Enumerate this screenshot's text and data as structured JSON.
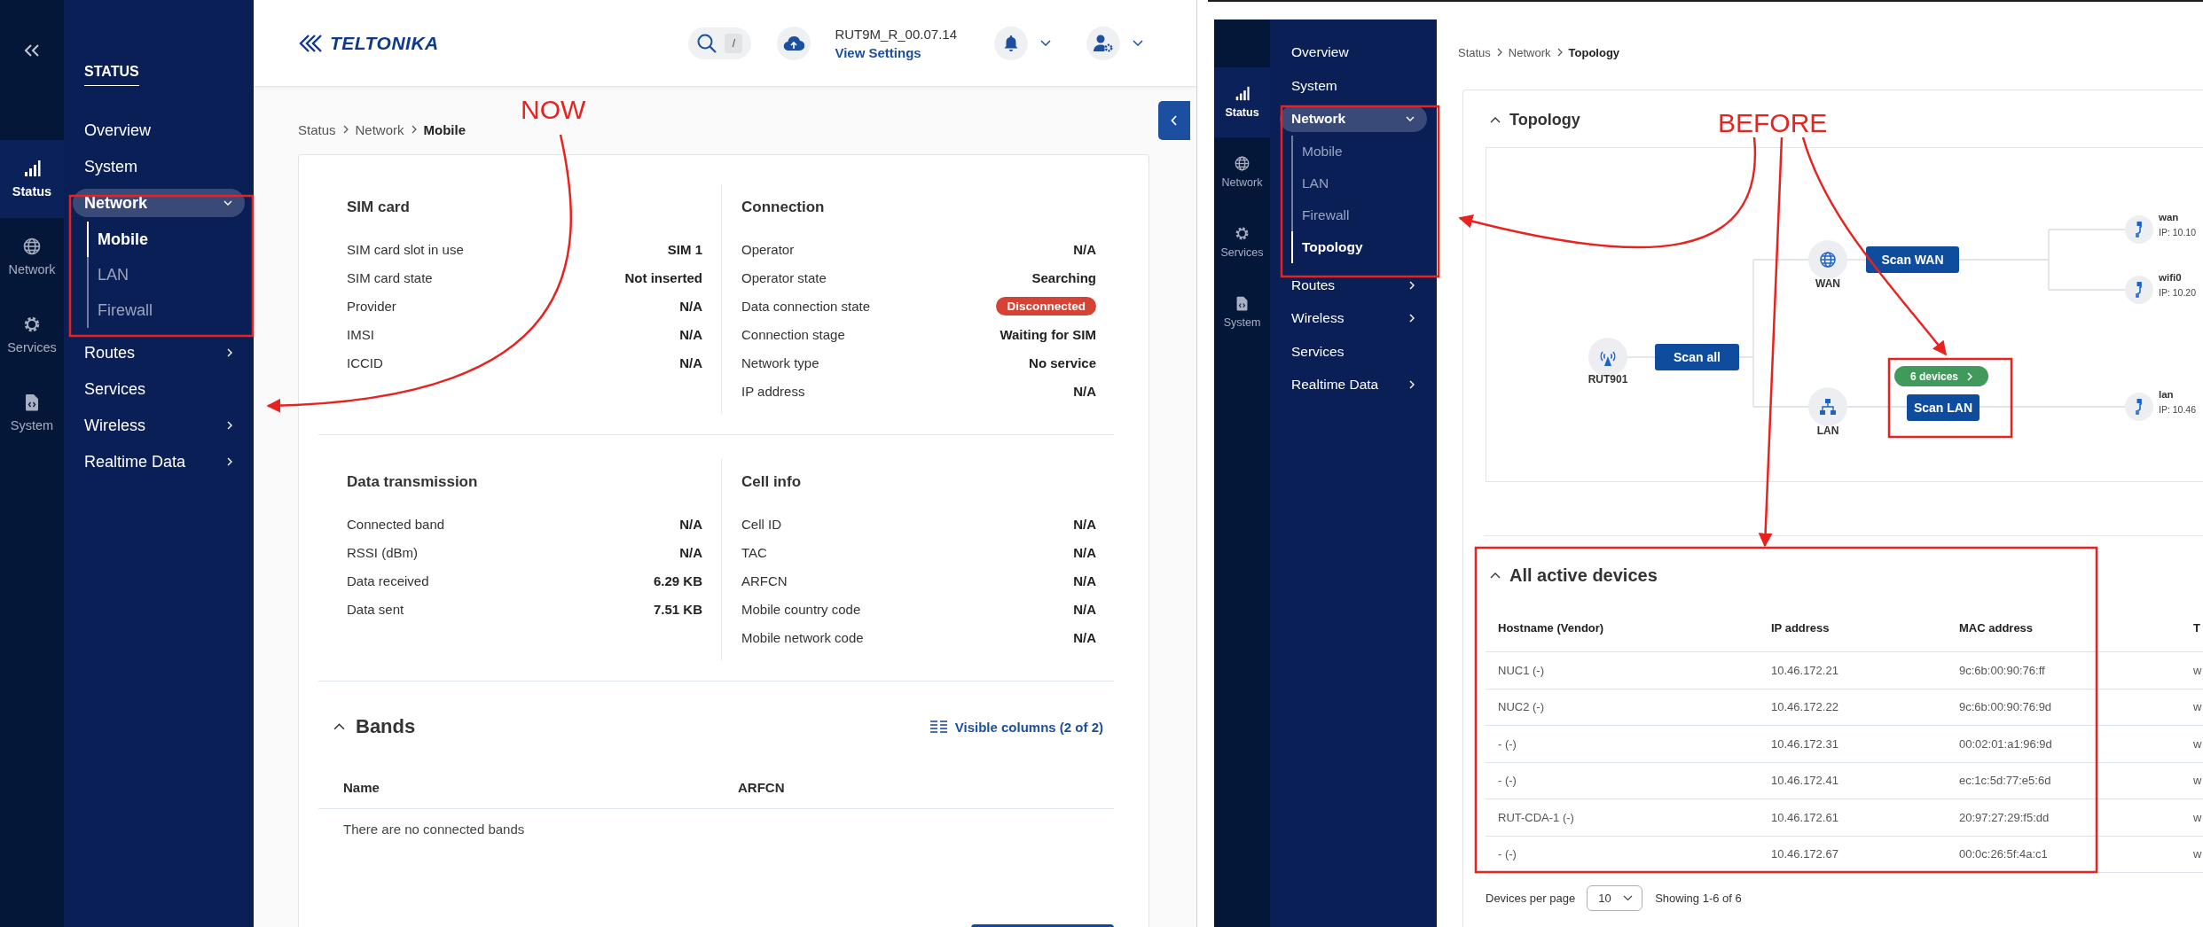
{
  "annotations": {
    "now_label": "NOW",
    "before_label": "BEFORE"
  },
  "now_screen": {
    "rail": {
      "items": [
        {
          "label": "Status",
          "kind": "status",
          "selected": true
        },
        {
          "label": "Network",
          "kind": "network",
          "selected": false
        },
        {
          "label": "Services",
          "kind": "services",
          "selected": false
        },
        {
          "label": "System",
          "kind": "system",
          "selected": false
        }
      ]
    },
    "nav": {
      "title": "STATUS",
      "items": [
        {
          "label": "Overview",
          "kind": "page",
          "selected": false
        },
        {
          "label": "System",
          "kind": "page",
          "selected": false
        },
        {
          "label": "Network",
          "kind": "group",
          "selected": true,
          "expanded": true,
          "children": [
            {
              "label": "Mobile",
              "selected": true
            },
            {
              "label": "LAN",
              "selected": false
            },
            {
              "label": "Firewall",
              "selected": false
            }
          ]
        },
        {
          "label": "Routes",
          "kind": "group",
          "selected": false,
          "expanded": false
        },
        {
          "label": "Services",
          "kind": "page",
          "selected": false
        },
        {
          "label": "Wireless",
          "kind": "group",
          "selected": false,
          "expanded": false
        },
        {
          "label": "Realtime Data",
          "kind": "group",
          "selected": false,
          "expanded": false
        }
      ]
    },
    "header": {
      "logo": "TELTONIKA",
      "search_shortcut": "/",
      "firmware": "RUT9M_R_00.07.14",
      "settings_link": "View Settings"
    },
    "breadcrumb": [
      "Status",
      "Network",
      "Mobile"
    ],
    "sections": [
      {
        "title": "SIM card",
        "rows": [
          {
            "label": "SIM card slot in use",
            "value": "SIM 1",
            "kind": "text"
          },
          {
            "label": "SIM card state",
            "value": "Not inserted",
            "kind": "text"
          },
          {
            "label": "Provider",
            "value": "N/A",
            "kind": "text"
          },
          {
            "label": "IMSI",
            "value": "N/A",
            "kind": "text"
          },
          {
            "label": "ICCID",
            "value": "N/A",
            "kind": "text"
          }
        ]
      },
      {
        "title": "Connection",
        "rows": [
          {
            "label": "Operator",
            "value": "N/A",
            "kind": "text"
          },
          {
            "label": "Operator state",
            "value": "Searching",
            "kind": "text"
          },
          {
            "label": "Data connection state",
            "value": "Disconnected",
            "kind": "badge"
          },
          {
            "label": "Connection stage",
            "value": "Waiting for SIM",
            "kind": "text"
          },
          {
            "label": "Network type",
            "value": "No service",
            "kind": "text"
          },
          {
            "label": "IP address",
            "value": "N/A",
            "kind": "text"
          }
        ]
      },
      {
        "title": "Data transmission",
        "rows": [
          {
            "label": "Connected band",
            "value": "N/A",
            "kind": "text"
          },
          {
            "label": "RSSI (dBm)",
            "value": "N/A",
            "kind": "text"
          },
          {
            "label": "Data received",
            "value": "6.29 KB",
            "kind": "text"
          },
          {
            "label": "Data sent",
            "value": "7.51 KB",
            "kind": "text"
          }
        ]
      },
      {
        "title": "Cell info",
        "rows": [
          {
            "label": "Cell ID",
            "value": "N/A",
            "kind": "text"
          },
          {
            "label": "TAC",
            "value": "N/A",
            "kind": "text"
          },
          {
            "label": "ARFCN",
            "value": "N/A",
            "kind": "text"
          },
          {
            "label": "Mobile country code",
            "value": "N/A",
            "kind": "text"
          },
          {
            "label": "Mobile network code",
            "value": "N/A",
            "kind": "text"
          }
        ]
      }
    ],
    "bands": {
      "title": "Bands",
      "expanded": true,
      "columns_link": "Visible columns (2 of 2)",
      "columns": [
        "Name",
        "ARFCN"
      ],
      "empty_text": "There are no connected bands"
    }
  },
  "before_screen": {
    "rail": {
      "items": [
        {
          "label": "Status",
          "kind": "status",
          "selected": true
        },
        {
          "label": "Network",
          "kind": "network",
          "selected": false
        },
        {
          "label": "Services",
          "kind": "services",
          "selected": false
        },
        {
          "label": "System",
          "kind": "system",
          "selected": false
        }
      ]
    },
    "nav": {
      "items": [
        {
          "label": "Overview",
          "kind": "page",
          "selected": false
        },
        {
          "label": "System",
          "kind": "page",
          "selected": false
        },
        {
          "label": "Network",
          "kind": "group",
          "selected": true,
          "expanded": true,
          "children": [
            {
              "label": "Mobile",
              "selected": false
            },
            {
              "label": "LAN",
              "selected": false
            },
            {
              "label": "Firewall",
              "selected": false
            },
            {
              "label": "Topology",
              "selected": true
            }
          ]
        },
        {
          "label": "Routes",
          "kind": "group",
          "selected": false,
          "expanded": false
        },
        {
          "label": "Wireless",
          "kind": "group",
          "selected": false,
          "expanded": false
        },
        {
          "label": "Services",
          "kind": "page",
          "selected": false
        },
        {
          "label": "Realtime Data",
          "kind": "group",
          "selected": false,
          "expanded": false
        }
      ]
    },
    "breadcrumb": [
      "Status",
      "Network",
      "Topology"
    ],
    "topology": {
      "title": "Topology",
      "expanded": true,
      "device": "RUT901",
      "scan_all": "Scan all",
      "wan": {
        "label": "WAN",
        "scan": "Scan WAN",
        "interfaces": [
          {
            "name": "wan",
            "ip": "IP: 10.10"
          },
          {
            "name": "wifi0",
            "ip": "IP: 10.20"
          }
        ]
      },
      "lan": {
        "label": "LAN",
        "scan": "Scan LAN",
        "devices_badge": "6 devices",
        "interfaces": [
          {
            "name": "lan",
            "ip": "IP: 10.46"
          }
        ]
      }
    },
    "devices": {
      "title": "All active devices",
      "expanded": true,
      "columns": [
        "Hostname (Vendor)",
        "IP address",
        "MAC address",
        "T"
      ],
      "rows": [
        [
          "NUC1 (-)",
          "10.46.172.21",
          "9c:6b:00:90:76:ff",
          "w"
        ],
        [
          "NUC2 (-)",
          "10.46.172.22",
          "9c:6b:00:90:76:9d",
          "w"
        ],
        [
          "- (-)",
          "10.46.172.31",
          "00:02:01:a1:96:9d",
          "w"
        ],
        [
          "- (-)",
          "10.46.172.41",
          "ec:1c:5d:77:e5:6d",
          "w"
        ],
        [
          "RUT-CDA-1 (-)",
          "10.46.172.61",
          "20:97:27:29:f5:dd",
          "w"
        ],
        [
          "- (-)",
          "10.46.172.67",
          "00:0c:26:5f:4a:c1",
          "w"
        ]
      ],
      "per_page_label": "Devices per page",
      "per_page": "10",
      "showing": "Showing 1-6 of 6"
    }
  }
}
